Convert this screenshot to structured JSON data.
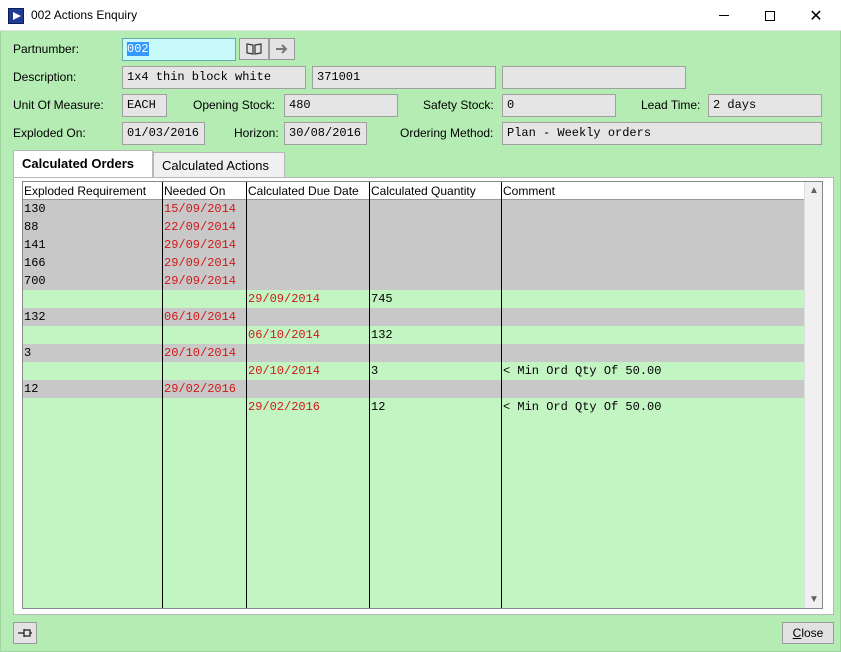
{
  "window": {
    "title": "002 Actions Enquiry",
    "minimize_glyph": "",
    "close_glyph": "✕"
  },
  "form": {
    "partnumber_label": "Partnumber:",
    "partnumber_value": "002",
    "description_label": "Description:",
    "description_value": "1x4 thin block white",
    "description_code": "371001",
    "description_extra": "",
    "uom_label": "Unit Of Measure:",
    "uom_value": "EACH",
    "opening_stock_label": "Opening Stock:",
    "opening_stock_value": "480",
    "safety_stock_label": "Safety Stock:",
    "safety_stock_value": "0",
    "lead_time_label": "Lead Time:",
    "lead_time_value": "2 days",
    "exploded_on_label": "Exploded On:",
    "exploded_on_value": "01/03/2016",
    "horizon_label": "Horizon:",
    "horizon_value": "30/08/2016",
    "ordering_method_label": "Ordering Method:",
    "ordering_method_value": "Plan - Weekly orders"
  },
  "icons": {
    "lookup": "book-icon",
    "go": "arrow-right-icon",
    "pin": "pin-icon"
  },
  "tabs": [
    {
      "label": "Calculated Orders",
      "active": true
    },
    {
      "label": "Calculated Actions",
      "active": false
    }
  ],
  "grid": {
    "columns": [
      "Exploded Requirement",
      "Needed On",
      "Calculated Due Date",
      "Calculated Quantity",
      "Comment"
    ],
    "rows": [
      {
        "kind": "req",
        "req": "130",
        "needed": "15/09/2014",
        "due": "",
        "qty": "",
        "comment": ""
      },
      {
        "kind": "req",
        "req": "88",
        "needed": "22/09/2014",
        "due": "",
        "qty": "",
        "comment": ""
      },
      {
        "kind": "req",
        "req": "141",
        "needed": "29/09/2014",
        "due": "",
        "qty": "",
        "comment": ""
      },
      {
        "kind": "req",
        "req": "166",
        "needed": "29/09/2014",
        "due": "",
        "qty": "",
        "comment": ""
      },
      {
        "kind": "req",
        "req": "700",
        "needed": "29/09/2014",
        "due": "",
        "qty": "",
        "comment": ""
      },
      {
        "kind": "ord",
        "req": "",
        "needed": "",
        "due": "29/09/2014",
        "qty": "745",
        "comment": ""
      },
      {
        "kind": "req",
        "req": "132",
        "needed": "06/10/2014",
        "due": "",
        "qty": "",
        "comment": ""
      },
      {
        "kind": "ord",
        "req": "",
        "needed": "",
        "due": "06/10/2014",
        "qty": "132",
        "comment": ""
      },
      {
        "kind": "req",
        "req": "3",
        "needed": "20/10/2014",
        "due": "",
        "qty": "",
        "comment": ""
      },
      {
        "kind": "ord",
        "req": "",
        "needed": "",
        "due": "20/10/2014",
        "qty": "3",
        "comment": "< Min Ord Qty Of 50.00"
      },
      {
        "kind": "req",
        "req": "12",
        "needed": "29/02/2016",
        "due": "",
        "qty": "",
        "comment": ""
      },
      {
        "kind": "ord",
        "req": "",
        "needed": "",
        "due": "29/02/2016",
        "qty": "12",
        "comment": "< Min Ord Qty Of 50.00"
      }
    ]
  },
  "footer": {
    "close_label_first": "C",
    "close_label_rest": "lose"
  },
  "colors": {
    "background": "#b4ecb4",
    "requirement_row": "#c8c8c8",
    "order_row": "#c3f5c3",
    "date_text": "#d01818"
  }
}
